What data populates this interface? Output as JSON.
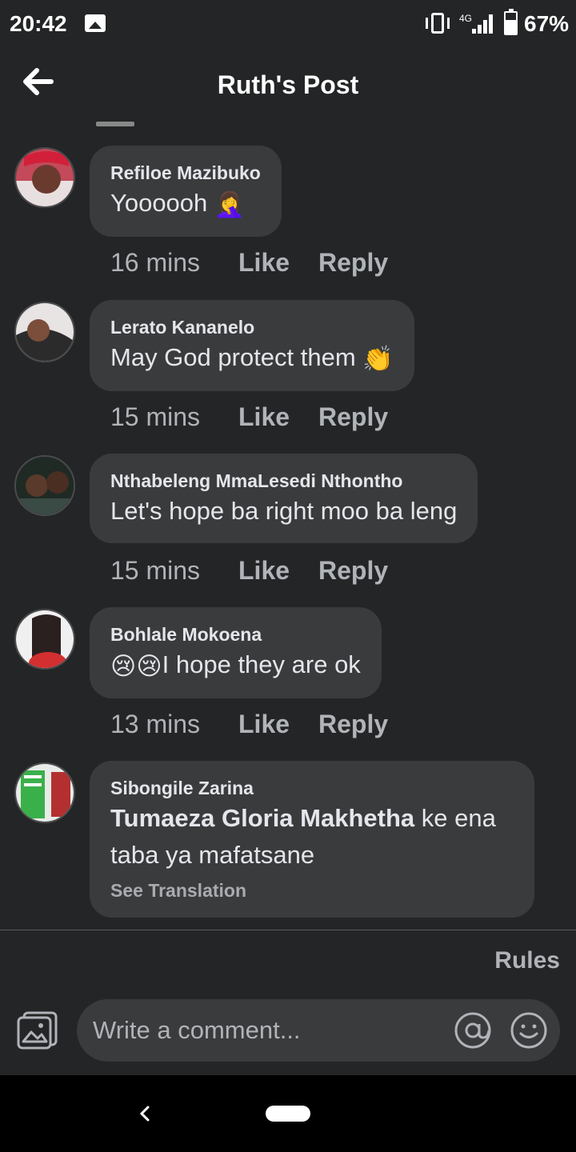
{
  "status_bar": {
    "time": "20:42",
    "network": "4G",
    "battery": "67%",
    "battery_level": 0.67
  },
  "header": {
    "title": "Ruth's Post"
  },
  "comments": [
    {
      "author": "Refiloe Mazibuko",
      "text": "Yoooooh",
      "emoji": "🤦‍♀️",
      "time": "16 mins",
      "like": "Like",
      "reply": "Reply"
    },
    {
      "author": "Lerato Kananelo",
      "text": "May God protect them",
      "emoji": "👏",
      "time": "15 mins",
      "like": "Like",
      "reply": "Reply"
    },
    {
      "author": "Nthabeleng MmaLesedi Nthontho",
      "text": "Let's hope ba right moo ba leng",
      "time": "15 mins",
      "like": "Like",
      "reply": "Reply"
    },
    {
      "author": "Bohlale Mokoena",
      "emoji": "😢😢",
      "text": "I hope they are ok",
      "time": "13 mins",
      "like": "Like",
      "reply": "Reply"
    },
    {
      "author": "Sibongile Zarina",
      "mention": "Tumaeza Gloria Makhetha",
      "text_line1": " ke ena",
      "text_line2": "taba ya mafatsane",
      "see_translation": "See Translation"
    }
  ],
  "footer": {
    "rules": "Rules",
    "input_placeholder": "Write a comment..."
  },
  "colors": {
    "background": "#242526",
    "bubble": "#3a3b3c",
    "text": "#e4e6eb",
    "secondary_text": "#b0b3b8"
  }
}
